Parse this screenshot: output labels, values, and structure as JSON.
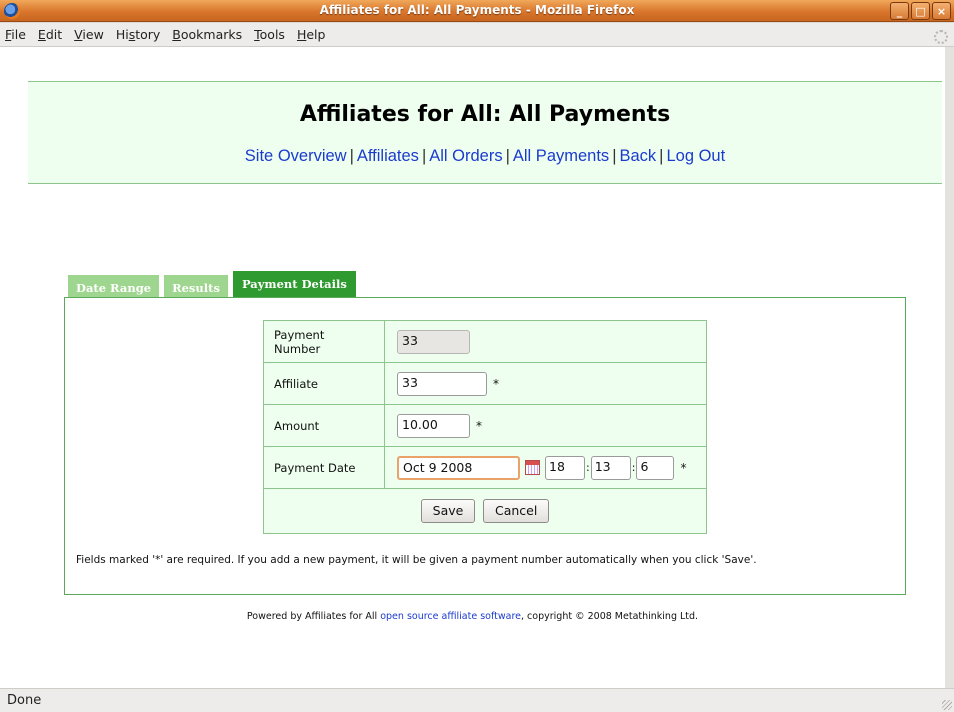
{
  "window": {
    "title": "Affiliates for All: All Payments - Mozilla Firefox",
    "buttons": {
      "minimize": "_",
      "maximize": "□",
      "close": "×"
    }
  },
  "menu": [
    {
      "pre": "",
      "u": "F",
      "post": "ile"
    },
    {
      "pre": "",
      "u": "E",
      "post": "dit"
    },
    {
      "pre": "",
      "u": "V",
      "post": "iew"
    },
    {
      "pre": "Hi",
      "u": "s",
      "post": "tory"
    },
    {
      "pre": "",
      "u": "B",
      "post": "ookmarks"
    },
    {
      "pre": "",
      "u": "T",
      "post": "ools"
    },
    {
      "pre": "",
      "u": "H",
      "post": "elp"
    }
  ],
  "page": {
    "heading": "Affiliates for All: All Payments",
    "nav": [
      "Site Overview",
      "Affiliates",
      "All Orders",
      "All Payments",
      "Back",
      "Log Out"
    ],
    "nav_separator": "|"
  },
  "tabs": [
    "Date Range",
    "Results",
    "Payment Details"
  ],
  "form": {
    "payment_number": {
      "label": "Payment Number",
      "value": "33"
    },
    "affiliate": {
      "label": "Affiliate",
      "value": "33"
    },
    "amount": {
      "label": "Amount",
      "value": "10.00"
    },
    "payment_date": {
      "label": "Payment Date",
      "date": "Oct 9 2008",
      "hour": "18",
      "minute": "13",
      "second": "6"
    },
    "required_mark": "*",
    "time_separator": ":",
    "save_label": "Save",
    "cancel_label": "Cancel"
  },
  "hint": "Fields marked '*' are required. If you add a new payment, it will be given a payment number automatically when you click 'Save'.",
  "footer": {
    "prefix": "Powered by Affiliates for All ",
    "link": "open source affiliate software",
    "suffix": ", copyright © 2008 Metathinking Ltd."
  },
  "status": "Done",
  "colors": {
    "accent_green": "#2f9a2f",
    "link_blue": "#1b3bcf",
    "titlebar_orange": "#d9762c"
  }
}
